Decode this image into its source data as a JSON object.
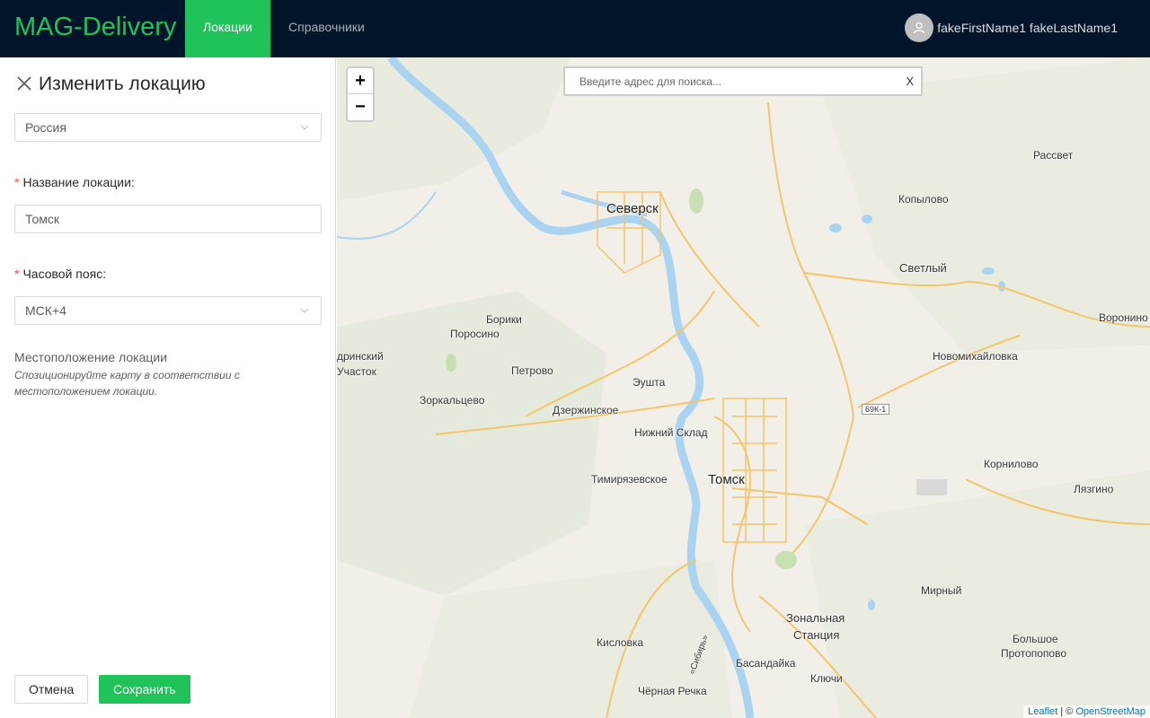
{
  "header": {
    "logo": "MAG-Delivery",
    "nav": [
      "Локации",
      "Справочники"
    ],
    "user_name": "fakeFirstName1 fakeLastName1"
  },
  "form": {
    "title": "Изменить локацию",
    "country": "Россия",
    "name_label": "Название локации",
    "name_value": "Томск",
    "timezone_label": "Часовой пояс",
    "timezone_value": "МСК+4",
    "location_title": "Местоположение локации",
    "location_hint": "Спозиционируйте карту в соответствии с местоположением локации.",
    "cancel_label": "Отмена",
    "save_label": "Сохранить"
  },
  "map": {
    "zoom_in": "+",
    "zoom_out": "−",
    "search_placeholder": "Введите адрес для поиска...",
    "search_clear": "X",
    "road_shield": "69К-1",
    "places": {
      "seversk": "Северск",
      "tomsk": "Томск",
      "rassvet": "Рассвет",
      "kopylovo": "Копылово",
      "svetly": "Светлый",
      "voronino": "Воронино",
      "novomikhaylovka": "Новомихайловка",
      "boriki": "Борики",
      "porosino": "Поросино",
      "petrovo": "Петрово",
      "eushta": "Эушта",
      "dzerzhinskoe": "Дзержинское",
      "nizhniy_sklad": "Нижний Склад",
      "zorkaltsevo": "Зоркальцево",
      "timiryazevskoe": "Тимирязевское",
      "kornilovo": "Корнилово",
      "lyazgino": "Лязгино",
      "mirny": "Мирный",
      "zonalnaya": "Зональная",
      "stantsiya": "Станция",
      "bolshoe": "Большое",
      "protopopovo": "Протопопово",
      "kislovka": "Кисловка",
      "basandayka": "Басандайка",
      "klyuchi": "Ключи",
      "chernaya_rechka": "Чёрная Речка",
      "uchastok_top": "дринский",
      "uchastok": "Участок",
      "sibir": "«Сибирь»"
    },
    "attribution_leaflet": "Leaflet",
    "attribution_sep": " | © ",
    "attribution_osm": "OpenStreetMap"
  },
  "colors": {
    "header_bg": "#001529",
    "accent": "#1fc35a",
    "water": "#aad3f2",
    "road": "#f2c66b"
  }
}
